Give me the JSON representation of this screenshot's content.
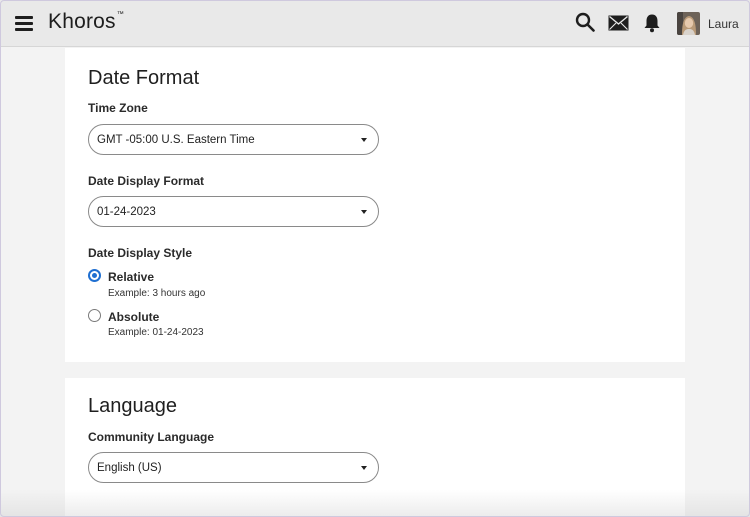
{
  "header": {
    "brand": "Khoros",
    "brand_mark": "™",
    "username": "Laura",
    "icons": [
      "menu-icon",
      "search-icon",
      "mail-icon",
      "bell-icon"
    ]
  },
  "date_format": {
    "title": "Date Format",
    "time_zone": {
      "label": "Time Zone",
      "value": "GMT -05:00 U.S. Eastern Time"
    },
    "display_format": {
      "label": "Date Display Format",
      "value": "01-24-2023"
    },
    "display_style": {
      "label": "Date Display Style",
      "options": [
        {
          "label": "Relative",
          "example": "Example: 3 hours ago",
          "selected": true
        },
        {
          "label": "Absolute",
          "example": "Example: 01-24-2023",
          "selected": false
        }
      ]
    }
  },
  "language": {
    "title": "Language",
    "community_language": {
      "label": "Community Language",
      "value": "English (US)"
    }
  },
  "colors": {
    "accent": "#1f6fd1",
    "header_bg": "#e9e9e9",
    "page_bg": "#f3f3f3",
    "card_bg": "#ffffff"
  }
}
